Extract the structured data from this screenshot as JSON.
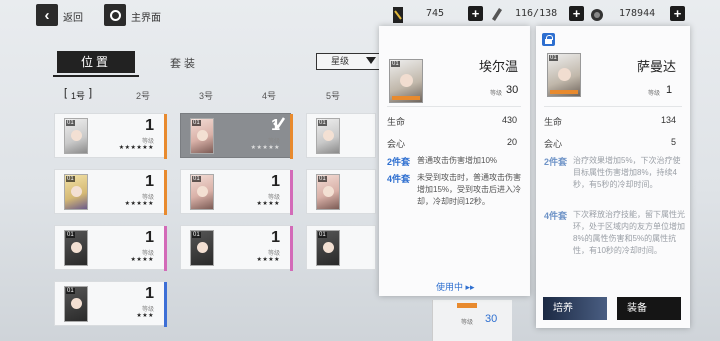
{
  "nav": {
    "back_label": "返回",
    "home_label": "主界面"
  },
  "resources": {
    "r1": "745",
    "r2": "116/138",
    "r3": "178944"
  },
  "tabs": {
    "position": "位置",
    "set": "套装"
  },
  "sort": {
    "label": "星级"
  },
  "slots": [
    "1号",
    "2号",
    "3号",
    "4号",
    "5号"
  ],
  "cards": [
    {
      "lv": "1",
      "lvlabel": "等级",
      "stars": "★★★★★★"
    },
    {
      "lv": "1",
      "lvlabel": "等级",
      "stars": "★★★★★"
    },
    {
      "lv": "1",
      "lvlabel": "等级",
      "stars": ""
    },
    {
      "lv": "1",
      "lvlabel": "等级",
      "stars": "★★★★★"
    },
    {
      "lv": "1",
      "lvlabel": "等级",
      "stars": "★★★★"
    },
    {
      "lv": "1",
      "lvlabel": "等级",
      "stars": ""
    },
    {
      "lv": "1",
      "lvlabel": "等级",
      "stars": "★★★★"
    },
    {
      "lv": "1",
      "lvlabel": "等级",
      "stars": "★★★★"
    },
    {
      "lv": "1",
      "lvlabel": "等级",
      "stars": ""
    },
    {
      "lv": "1",
      "lvlabel": "等级",
      "stars": "★★★"
    }
  ],
  "card_thumb_num": "01",
  "panel_left": {
    "name": "埃尔温",
    "level_label": "等级",
    "level": "30",
    "stats": [
      {
        "label": "生命",
        "value": "430"
      },
      {
        "label": "会心",
        "value": "20"
      }
    ],
    "set2_label": "2件套",
    "set2_text": "普通攻击伤害增加10%",
    "set4_label": "4件套",
    "set4_text": "未受到攻击时，普通攻击伤害增加15%，受到攻击后进入冷却，冷却时间12秒。",
    "in_use": "使用中 ▸▸"
  },
  "panel_right": {
    "name": "萨曼达",
    "level_label": "等级",
    "level": "1",
    "stats": [
      {
        "label": "生命",
        "value": "134"
      },
      {
        "label": "会心",
        "value": "5"
      }
    ],
    "set2_label": "2件套",
    "set2_text": "治疗效果增加5%，下次治疗使目标属性伤害增加8%，持续4秒，有5秒的冷却时间。",
    "set4_label": "4件套",
    "set4_text": "下次释放治疗技能，留下属性光环，处于区域内的友方单位增加8%的属性伤害和5%的属性抗性，有10秒的冷却时间。",
    "btn_cultivate": "培养",
    "btn_equip": "装备"
  },
  "behind": {
    "level_label": "等级",
    "level": "30"
  },
  "colors": {
    "accent_blue": "#2e6fd0",
    "orange": "#e88a2e",
    "pink": "#d36ab8",
    "blue_edge": "#3d6fd6"
  }
}
